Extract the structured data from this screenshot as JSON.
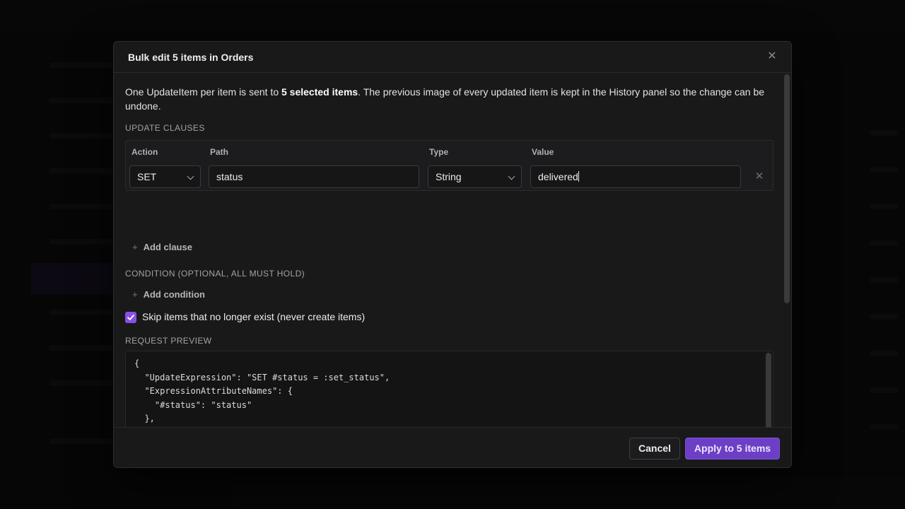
{
  "modal": {
    "title": "Bulk edit 5 items in Orders",
    "close_icon": "close-icon",
    "intro_before": "One UpdateItem per item is sent to ",
    "intro_bold": "5 selected items",
    "intro_after": ". The previous image of every updated item is kept in the History panel so the change can be undone."
  },
  "update_clauses": {
    "section_label": "UPDATE CLAUSES",
    "headers": {
      "action": "Action",
      "path": "Path",
      "type": "Type",
      "value": "Value"
    },
    "rows": [
      {
        "action": "SET",
        "path": "status",
        "type": "String",
        "value": "delivered"
      }
    ],
    "add_label": "Add clause"
  },
  "condition": {
    "section_label": "CONDITION (OPTIONAL, ALL MUST HOLD)",
    "add_label": "Add condition"
  },
  "skip_missing": {
    "checked": true,
    "label": "Skip items that no longer exist (never create items)"
  },
  "request_preview": {
    "section_label": "REQUEST PREVIEW",
    "code": "{\n  \"UpdateExpression\": \"SET #status = :set_status\",\n  \"ExpressionAttributeNames\": {\n    \"#status\": \"status\"\n  },\n  \"ExpressionAttributeValues\": {\n    \":set_status\": \"delivered\"\n  }\n}"
  },
  "footer": {
    "cancel_label": "Cancel",
    "apply_label": "Apply to 5 items"
  },
  "colors": {
    "accent": "#6c3fc6",
    "checkbox": "#8a4fe6",
    "modal_bg": "#19191a"
  }
}
